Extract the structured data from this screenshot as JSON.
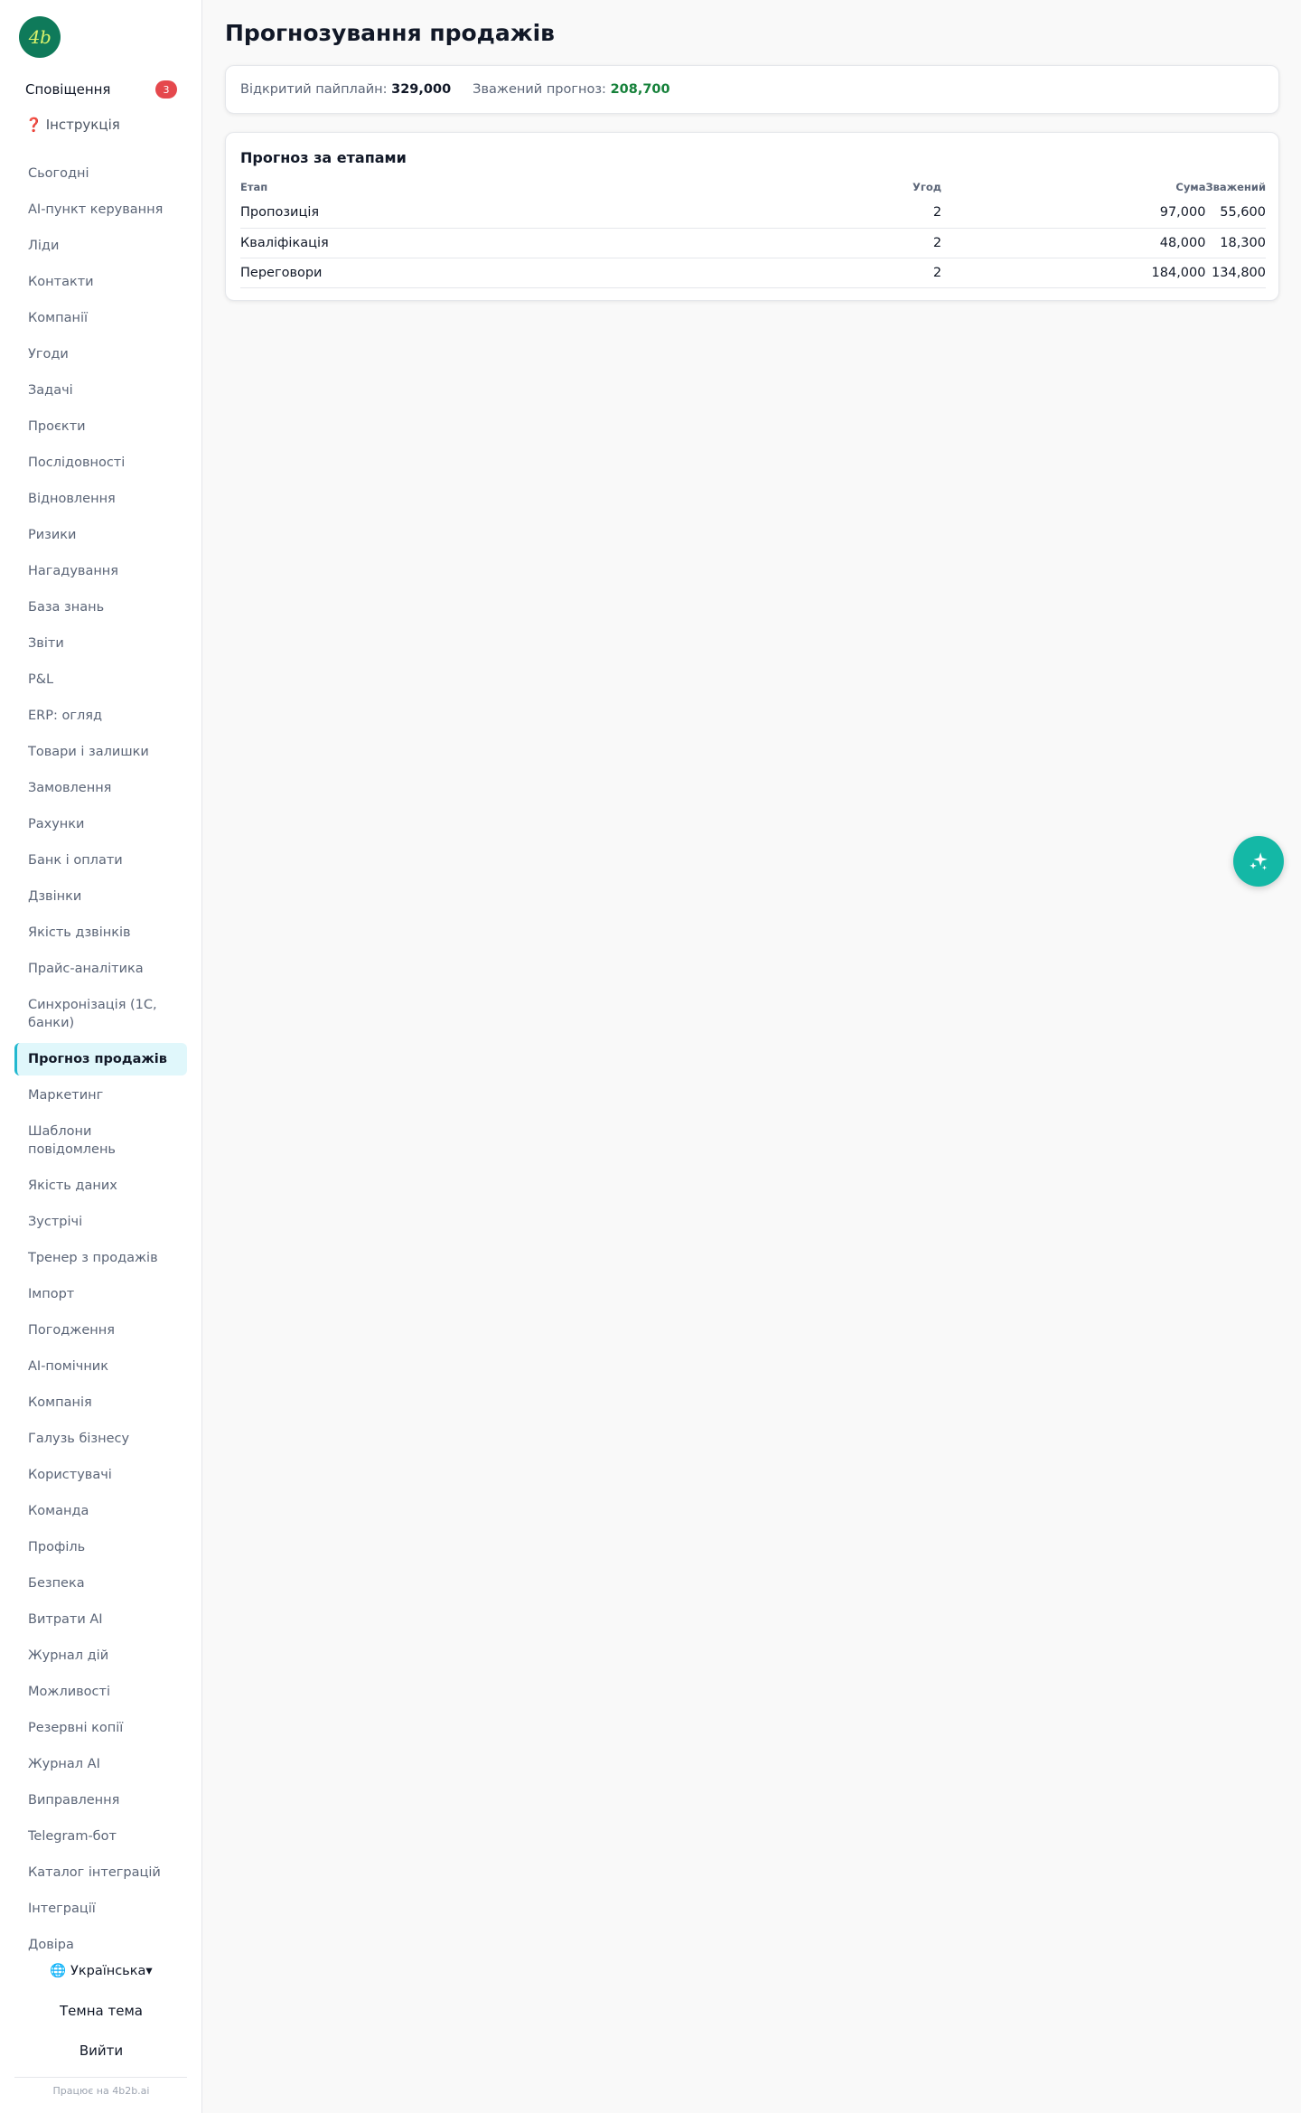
{
  "sidebar": {
    "logo_text": "4b",
    "notifications": {
      "label": "Сповіщення",
      "count": "3"
    },
    "instruction": {
      "icon": "question-icon",
      "label": "Інструкція"
    },
    "items": [
      "Сьогодні",
      "AI-пункт керування",
      "Ліди",
      "Контакти",
      "Компанії",
      "Угоди",
      "Задачі",
      "Проєкти",
      "Послідовності",
      "Відновлення",
      "Ризики",
      "Нагадування",
      "База знань",
      "Звіти",
      "P&L",
      "ERP: огляд",
      "Товари і залишки",
      "Замовлення",
      "Рахунки",
      "Банк і оплати",
      "Дзвінки",
      "Якість дзвінків",
      "Прайс-аналітика",
      "Синхронізація (1С, банки)",
      "Прогноз продажів",
      "Маркетинг",
      "Шаблони повідомлень",
      "Якість даних",
      "Зустрічі",
      "Тренер з продажів",
      "Імпорт",
      "Погодження",
      "AI-помічник",
      "Компанія",
      "Галузь бізнесу",
      "Користувачі",
      "Команда",
      "Профіль",
      "Безпека",
      "Витрати AI",
      "Журнал дій",
      "Можливості",
      "Резервні копії",
      "Журнал AI",
      "Виправлення",
      "Telegram-бот",
      "Каталог інтеграцій",
      "Інтеграції",
      "Довіра"
    ],
    "active_item": "Прогноз продажів",
    "language": {
      "icon": "globe-icon",
      "label": "Українська▾"
    },
    "theme_label": "Темна тема",
    "logout_label": "Вийти",
    "powered_by": "Працює на 4b2b.ai"
  },
  "main": {
    "title": "Прогнозування продажів",
    "summary": {
      "pipeline_label": "Відкритий пайплайн:",
      "pipeline_value": "329,000",
      "weighted_label": "Зважений прогноз:",
      "weighted_value": "208,700"
    },
    "stage_card": {
      "title": "Прогноз за етапами",
      "columns": [
        "Етап",
        "Угод",
        "Сума",
        "Зважений"
      ],
      "rows": [
        [
          "Пропозиція",
          "2",
          "97,000",
          "55,600"
        ],
        [
          "Кваліфікація",
          "2",
          "48,000",
          "18,300"
        ],
        [
          "Переговори",
          "2",
          "184,000",
          "134,800"
        ]
      ]
    }
  },
  "fab": {
    "icon": "sparkles-icon"
  },
  "colors": {
    "brand": "#0f7a5a",
    "accent": "#22b8cf",
    "active_bg": "#e0f7fb",
    "badge": "#e5484d",
    "weighted_value": "#16813a",
    "fab": "#14b8a6"
  }
}
